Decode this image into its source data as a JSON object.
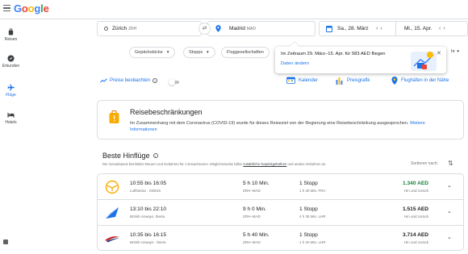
{
  "app": {
    "logo": "Google",
    "colors": {
      "accent": "#1a73e8",
      "price_good": "#188038",
      "border": "#dadce0"
    }
  },
  "sidebar": {
    "items": [
      {
        "label": "Reisen",
        "icon": "luggage-icon",
        "active": false
      },
      {
        "label": "Erkunden",
        "icon": "compass-icon",
        "active": false
      },
      {
        "label": "Flüge",
        "icon": "plane-icon",
        "active": true
      },
      {
        "label": "Hotels",
        "icon": "bed-icon",
        "active": false
      }
    ]
  },
  "search": {
    "origin": "Zürich",
    "origin_code": "ZRH",
    "destination": "Madrid",
    "destination_code": "MAD",
    "depart_date": "Sa., 28. März",
    "return_date": "Mi., 15. Apr."
  },
  "filters": {
    "chips": [
      "Gepäckstücke",
      "Stopps",
      "Fluggesellschaften"
    ],
    "more_label": "hr"
  },
  "popup": {
    "message": "Im Zeitraum 29. März–15. Apr. für 583 AED fliegen",
    "link": "Daten ändern"
  },
  "tools": {
    "track_label": "Preise beobachten",
    "calendar_label": "Kalender",
    "graph_label": "Preisgrafik",
    "nearby_label": "Flughäfen in der Nähe"
  },
  "restrictions": {
    "title": "Reisebeschränkungen",
    "body": "Im Zusammenhang mit dem Coronavirus (COVID-19) wurde für dieses Reiseziel von der Regierung eine Reisebeschränkung ausgesprochen.",
    "link": "Weitere Informationen"
  },
  "results": {
    "title": "Beste Hinflüge",
    "subtitle_a": "Der Gesamtpreis beinhaltet Steuern und Gebühren für 1 Erwachsenen. Möglicherweise fallen ",
    "subtitle_link": "zusätzliche Gepäckgebühren",
    "subtitle_b": " und andere Gebühren an.",
    "sort_label": "Sortieren nach:",
    "flights": [
      {
        "times": "10:55 bis 16:05",
        "carrier": "Lufthansa · SWISS",
        "duration": "5 h 10 Min.",
        "route": "ZRH–MAD",
        "stops": "1 Stopp",
        "layover": "1 h 30 Min. FRA",
        "price": "1.340 AED",
        "price_type": "Hin und zurück",
        "cheap": true,
        "logo_icon": "lufthansa-logo-icon"
      },
      {
        "times": "13:10 bis 22:10",
        "carrier": "British Airways, Iberia",
        "duration": "9 h 0 Min.",
        "route": "ZRH–MAD",
        "stops": "1 Stopp",
        "layover": "4 h 35 Min. LHR",
        "price": "1.515 AED",
        "price_type": "Hin und zurück",
        "cheap": false,
        "logo_icon": "multi-airline-logo-icon"
      },
      {
        "times": "10:35 bis 16:15",
        "carrier": "British Airways · Iberia",
        "duration": "5 h 40 Min.",
        "route": "ZRH–MAD",
        "stops": "1 Stopp",
        "layover": "1 h 20 Min. LHR",
        "price": "3.714 AED",
        "price_type": "Hin und zurück",
        "cheap": false,
        "logo_icon": "british-airways-logo-icon"
      }
    ]
  }
}
